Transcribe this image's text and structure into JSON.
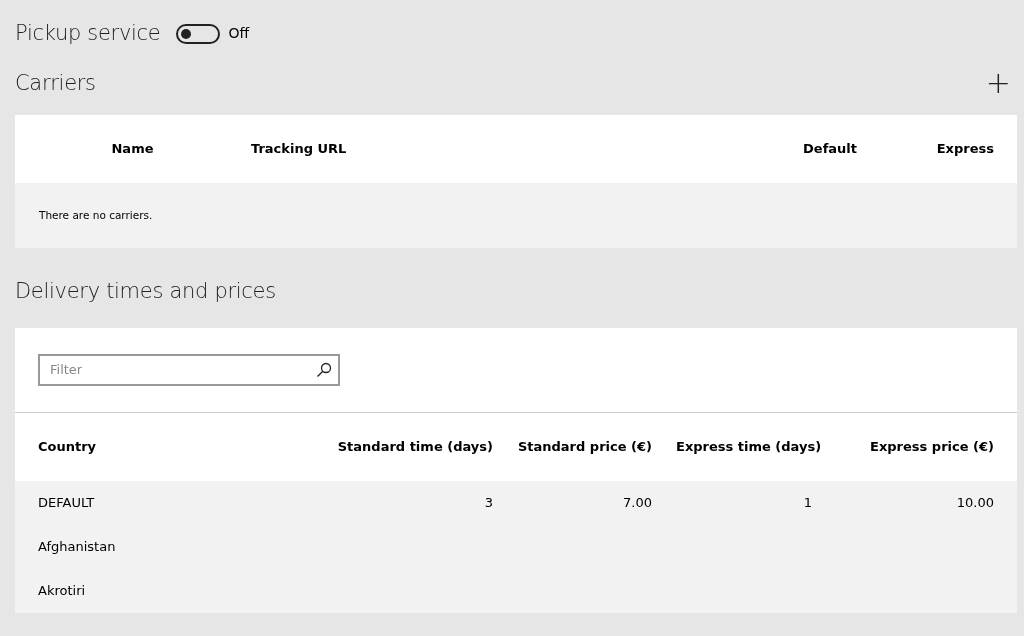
{
  "pickup_service": {
    "label": "Pickup service",
    "on": false,
    "state_label": "Off"
  },
  "carriers": {
    "title": "Carriers",
    "add_symbol": "+",
    "columns": [
      "Name",
      "Tracking URL",
      "Default",
      "Express"
    ],
    "empty_message": "There are no carriers."
  },
  "delivery": {
    "title": "Delivery times and prices",
    "filter": {
      "placeholder": "Filter"
    },
    "columns": [
      "Country",
      "Standard time (days)",
      "Standard price (€)",
      "Express time (days)",
      "Express price (€)"
    ],
    "rows": [
      {
        "country": "DEFAULT",
        "standard_time": "3",
        "standard_price": "7.00",
        "express_time": "1",
        "express_price": "10.00"
      },
      {
        "country": "Afghanistan"
      },
      {
        "country": "Akrotiri"
      }
    ]
  }
}
